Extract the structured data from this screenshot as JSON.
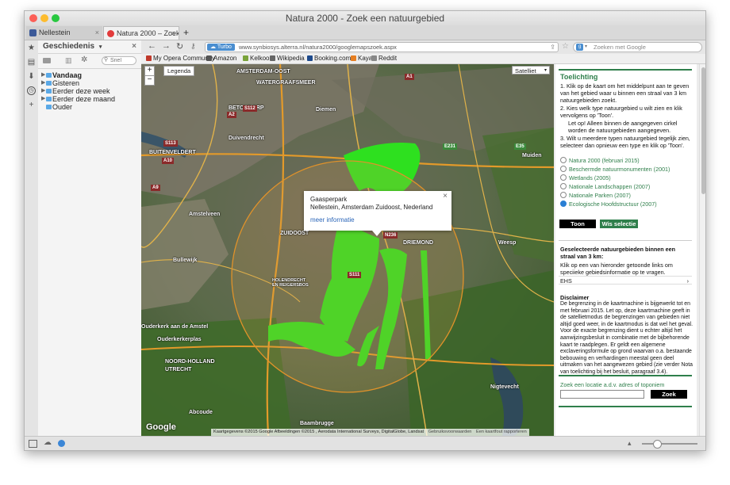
{
  "window": {
    "title": "Natura 2000 - Zoek een natuurgebied"
  },
  "tabs": [
    {
      "label": "Nellestein",
      "active": false
    },
    {
      "label": "Natura 2000 – Zoek ...",
      "active": true
    }
  ],
  "sidebar_panel": {
    "title": "Geschiedenis",
    "search_placeholder": "Snel",
    "items": [
      {
        "label": "Vandaag",
        "bold": true
      },
      {
        "label": "Gisteren",
        "bold": false
      },
      {
        "label": "Eerder deze week",
        "bold": false
      },
      {
        "label": "Eerder deze maand",
        "bold": false
      },
      {
        "label": "Ouder",
        "bold": false
      }
    ]
  },
  "navbar": {
    "turbo_label": "Turbo",
    "url": "www.synbiosys.alterra.nl/natura2000/googlemapszoek.aspx",
    "search_placeholder": "Zoeken met Google"
  },
  "bookmarks": [
    {
      "label": "My Opera Community",
      "color": "#c0392b"
    },
    {
      "label": "Amazon",
      "color": "#555555"
    },
    {
      "label": "Kelkoo",
      "color": "#7aa33a"
    },
    {
      "label": "Wikipedia",
      "color": "#666666"
    },
    {
      "label": "Booking.com",
      "color": "#1e4a8c"
    },
    {
      "label": "Kayak",
      "color": "#e67e22"
    },
    {
      "label": "Reddit",
      "color": "#888888"
    }
  ],
  "map": {
    "legend_label": "Legenda",
    "maptype_label": "Satelliet",
    "zoom_in": "+",
    "zoom_out": "−",
    "google_logo": "Google",
    "attribution": "Kaartgegevens ©2015 Google Afbeeldingen ©2015 , Aerodata International Surveys, DigitalGlobe, Landsat",
    "terms": "Gebruiksvoorwaarden",
    "report": "Een kaartfout rapporteren",
    "popup": {
      "title": "Gaasperpark",
      "address": "Nellestein, Amsterdam Zuidoost, Nederland",
      "link": "meer informatie",
      "close": "×"
    },
    "labels": [
      {
        "text": "AMSTERDAM-OOST"
      },
      {
        "text": "WATERGRAAFSMEER"
      },
      {
        "text": "BETONDORP"
      },
      {
        "text": "Diemen"
      },
      {
        "text": "Duivendrecht"
      },
      {
        "text": "BUITENVELDERT"
      },
      {
        "text": "Amstelveen"
      },
      {
        "text": "ZUIDOOST"
      },
      {
        "text": "DRIEMOND"
      },
      {
        "text": "Weesp"
      },
      {
        "text": "Bullewijk"
      },
      {
        "text": "HOLENDRECHT EN REIGERSBOS"
      },
      {
        "text": "Ouderkerk aan de Amstel"
      },
      {
        "text": "Ouderkerkerplas"
      },
      {
        "text": "NOORD-HOLLAND"
      },
      {
        "text": "UTRECHT"
      },
      {
        "text": "Abcoude"
      },
      {
        "text": "Baambrugge"
      },
      {
        "text": "Nigtevecht"
      },
      {
        "text": "Muiden"
      }
    ],
    "shields": [
      "A10",
      "A1",
      "A2",
      "A9",
      "E231",
      "S112",
      "S113",
      "N236",
      "S111",
      "E35"
    ]
  },
  "right_panel": {
    "heading": "Toelichting",
    "steps": [
      "1.  Klik op de kaart om het middelpunt aan te geven van het gebied waar u binnen een straal van 3 km natuurgebieden zoekt.",
      "2.  Kies welk type natuurgebied u wilt zien en klik vervolgens op 'Toon'.",
      "Let op! Alleen binnen de aangegeven cirkel worden de natuurgebieden aangegeven.",
      "3.  Wilt u meerdere typen natuurgebied tegelijk zien, selecteer dan opnieuw een type en klik op 'Toon'."
    ],
    "options": [
      {
        "label": "Natura 2000 (februari 2015)",
        "selected": false
      },
      {
        "label": "Beschermde natuurmonumenten (2001)",
        "selected": false
      },
      {
        "label": "Wetlands (2005)",
        "selected": false
      },
      {
        "label": "Nationale Landschappen (2007)",
        "selected": false
      },
      {
        "label": "Nationale Parken (2007)",
        "selected": false
      },
      {
        "label": "Ecologische Hoofdstructuur (2007)",
        "selected": true
      }
    ],
    "toon_label": "Toon",
    "wis_label": "Wis selectie",
    "selected_heading": "Geselecteerde natuurgebieden binnen een straal van 3 km:",
    "selected_text": "Klik op een van hieronder getoonde links om speciieke gebiedsinformatie op te vragen.",
    "ehs_label": "EHS",
    "disclaimer_heading": "Disclaimer",
    "disclaimer_text": "De begrenzing in de kaartmachine is bijgewerkt tot en met februari 2015. Let op, deze kaartmachine geeft in de satellietmodus de begrenzingen van gebieden niet altijd goed weer, in de kaartmodus is dat wel het geval. Voor de exacte begrenzing dient u echter altijd het aanwijzingsbesluit in combinatie met de bijbehorende kaart te raadplegen. Er geldt een algemene exclaveringsformule op grond waarvan o.a. bestaande bebouwing en verhardingen meestal geen deel uitmaken van het aangewezen gebied (zie verder Nota van toelichting bij het besluit, paragraaf 3.4).",
    "search_label": "Zoek een locatie a.d.v. adres of toponiem",
    "search_button": "Zoek"
  }
}
